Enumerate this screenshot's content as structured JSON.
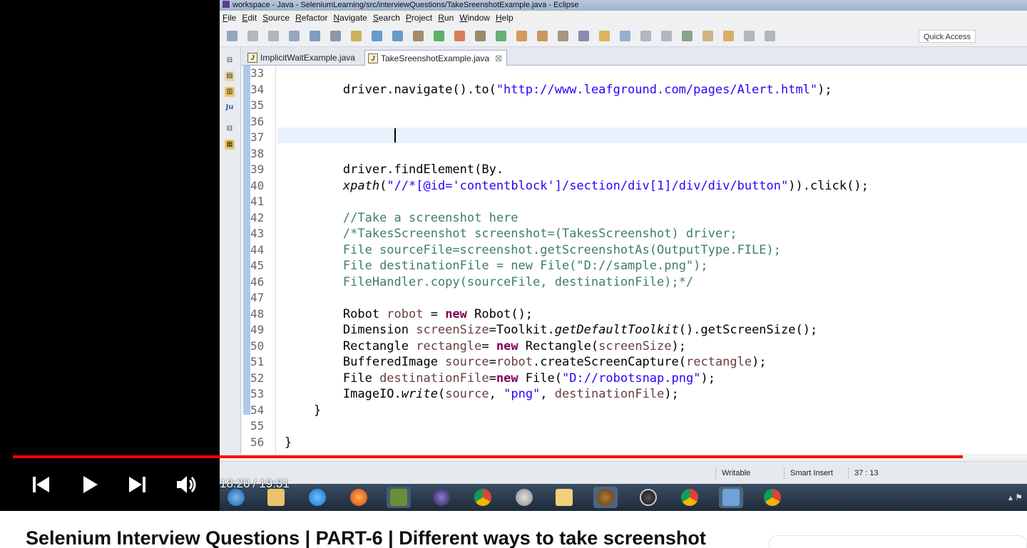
{
  "eclipse": {
    "window_title": "workspace - Java - SeleniumLearning/src/interviewQuestions/TakeSreenshotExample.java - Eclipse",
    "menu": [
      {
        "label": "File",
        "u": "F",
        "rest": "ile"
      },
      {
        "label": "Edit",
        "u": "E",
        "rest": "dit"
      },
      {
        "label": "Source",
        "u": "S",
        "rest": "ource"
      },
      {
        "label": "Refactor",
        "u": "R",
        "rest": "efactor"
      },
      {
        "label": "Navigate",
        "u": "N",
        "rest": "avigate"
      },
      {
        "label": "Search",
        "u": "S",
        "rest": "earch"
      },
      {
        "label": "Project",
        "u": "P",
        "rest": "roject"
      },
      {
        "label": "Run",
        "u": "R",
        "rest": "un"
      },
      {
        "label": "Window",
        "u": "W",
        "rest": "indow"
      },
      {
        "label": "Help",
        "u": "H",
        "rest": "elp"
      }
    ],
    "quick_access": "Quick Access",
    "tabs": [
      {
        "label": "ImplicitWaitExample.java",
        "icon": "J"
      },
      {
        "label": "TakeSreenshotExample.java",
        "icon": "J",
        "close": "☒"
      }
    ],
    "code": [
      {
        "num": "33",
        "html": ""
      },
      {
        "num": "34",
        "html": "        driver.navigate().to(<span class=\"str\">\"http://www.leafground.com/pages/Alert.html\"</span>);"
      },
      {
        "num": "35",
        "html": ""
      },
      {
        "num": "36",
        "html": ""
      },
      {
        "num": "37",
        "html": ""
      },
      {
        "num": "38",
        "html": ""
      },
      {
        "num": "39",
        "html": "        driver.findElement(By."
      },
      {
        "num": "40",
        "html": "        <span class=\"it\">xpath</span>(<span class=\"str\">\"//*[@id='contentblock']/section/div[1]/div/div/button\"</span>)).click();"
      },
      {
        "num": "41",
        "html": ""
      },
      {
        "num": "42",
        "html": "        <span class=\"cm\">//Take a screenshot here</span>"
      },
      {
        "num": "43",
        "html": "        <span class=\"cm\">/*TakesScreenshot screenshot=(TakesScreenshot) driver;</span>"
      },
      {
        "num": "44",
        "html": "        <span class=\"cm\">File sourceFile=screenshot.getScreenshotAs(OutputType.FILE);</span>"
      },
      {
        "num": "45",
        "html": "        <span class=\"cm\">File destinationFile = new File(\"D://sample.png\");</span>"
      },
      {
        "num": "46",
        "html": "        <span class=\"cm\">FileHandler.copy(sourceFile, destinationFile);*/</span>"
      },
      {
        "num": "47",
        "html": ""
      },
      {
        "num": "48",
        "html": "        Robot <span class=\"var\">robot</span> = <span class=\"kw\">new</span> Robot();"
      },
      {
        "num": "49",
        "html": "        Dimension <span class=\"var\">screenSize</span>=Toolkit.<span class=\"it\">getDefaultToolkit</span>().getScreenSize();"
      },
      {
        "num": "50",
        "html": "        Rectangle <span class=\"var\">rectangle</span>= <span class=\"kw\">new</span> Rectangle(<span class=\"var\">screenSize</span>);"
      },
      {
        "num": "51",
        "html": "        BufferedImage <span class=\"var\">source</span>=<span class=\"var\">robot</span>.createScreenCapture(<span class=\"var\">rectangle</span>);"
      },
      {
        "num": "52",
        "html": "        File <span class=\"var\">destinationFile</span>=<span class=\"kw\">new</span> File(<span class=\"str\">\"D://robotsnap.png\"</span>);"
      },
      {
        "num": "53",
        "html": "        ImageIO.<span class=\"it\">write</span>(<span class=\"var\">source</span>, <span class=\"str\">\"png\"</span>, <span class=\"var\">destinationFile</span>);"
      },
      {
        "num": "54",
        "html": "    }"
      },
      {
        "num": "55",
        "html": ""
      },
      {
        "num": "56",
        "html": "}"
      }
    ],
    "status": {
      "writable": "Writable",
      "insert_mode": "Smart Insert",
      "position": "37 : 13"
    }
  },
  "player": {
    "current_time": "18:20",
    "separator": "/",
    "duration": "19:31",
    "progress_fraction": 0.937
  },
  "video_title": "Selenium Interview Questions | PART-6 | Different ways to take screenshot",
  "colors": {
    "progress": "#ff0000",
    "keyword": "#7f0055",
    "string": "#2a00ff",
    "comment": "#3f7f5f"
  }
}
